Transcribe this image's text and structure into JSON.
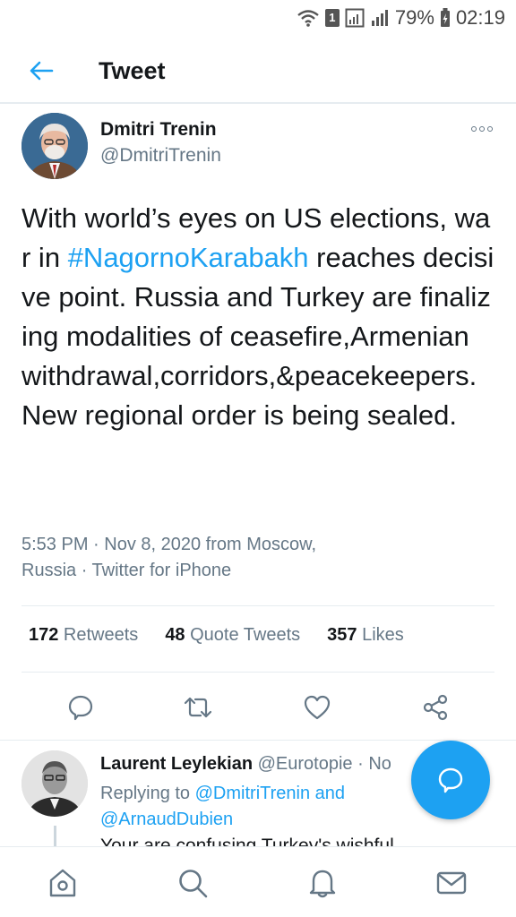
{
  "status_bar": {
    "sim_slot": "1",
    "battery": "79%",
    "time": "02:19"
  },
  "header": {
    "title": "Tweet",
    "back_icon": "arrow-left-icon"
  },
  "tweet": {
    "author_name": "Dmitri Trenin",
    "author_handle": "@DmitriTrenin",
    "text_before": "With world’s eyes on US elections, war in ",
    "hashtag": "#NagornoKarabakh",
    "text_after": " reaches decisive point. Russia and Turkey are finalizing modalities of ceasefire,Armenian withdrawal,corridors,&peacekeepers. New regional order is being sealed.",
    "meta_time": "5:53 PM · Nov 8, 2020 from Moscow,",
    "meta_place_client": "Russia · Twitter for iPhone",
    "stats": {
      "retweets_count": "172",
      "retweets_label": " Retweets",
      "quotes_count": "48",
      "quotes_label": " Quote Tweets",
      "likes_count": "357",
      "likes_label": " Likes"
    },
    "accent_color": "#1da1f2"
  },
  "reply": {
    "name": "Laurent Leylekian",
    "handle": "@Eurotopie",
    "separator": "· No",
    "replying_label": "Replying to ",
    "replying_user1": "@DmitriTrenin",
    "replying_and": " and",
    "replying_user2": "@ArnaudDubien",
    "text_partial": "Your are confusing Turkey's wishful"
  },
  "bottom_nav": {
    "items": [
      "home-icon",
      "search-icon",
      "notifications-icon",
      "messages-icon"
    ]
  }
}
